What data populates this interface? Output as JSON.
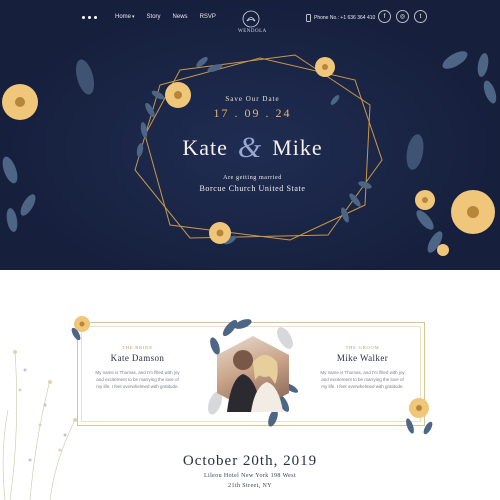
{
  "nav": {
    "links": [
      "Home",
      "Story",
      "News",
      "RSVP"
    ],
    "logo_text": "WENDOLA",
    "phone": "Phone No.: +1 636 364 410",
    "socials": [
      "f",
      "◎",
      "t"
    ]
  },
  "hero": {
    "save_label": "Save Our Date",
    "date": "17 . 09 . 24",
    "name_left": "Kate",
    "amp": "&",
    "name_right": "Mike",
    "getting_married": "Are getting married",
    "church": "Borcue Church United State"
  },
  "couple": {
    "bride": {
      "role": "THE BRIDE",
      "name": "Kate Damson",
      "bio": "My name is Thomas, and I'm filled with joy and excitement to be marrying the love of my life. I feel overwhelmed with gratitude."
    },
    "groom": {
      "role": "THE GROOM",
      "name": "Mike Walker",
      "bio": "My name is Thomas, and I'm filled with joy and excitement to be marrying the love of my life. I feel overwhelmed with gratitude."
    }
  },
  "event": {
    "date": "October 20th, 2019",
    "address_line1": "Lileou Hotel New York 198 West",
    "address_line2": "21th Street, NY"
  },
  "colors": {
    "hero_bg": "#16203d",
    "gold": "#d8a44c",
    "flower": "#f0c77a",
    "leaf": "#5b7290"
  }
}
